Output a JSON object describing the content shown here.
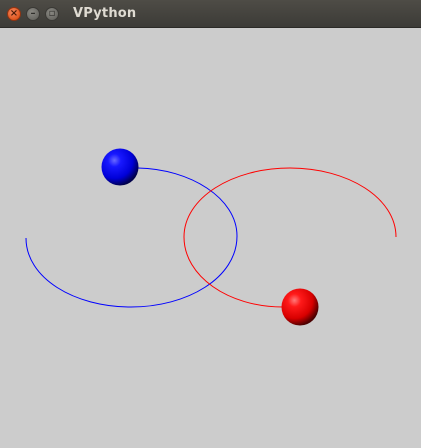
{
  "window": {
    "title": "VPython",
    "controls": {
      "close_glyph": "×",
      "minimize_glyph": "–",
      "maximize_glyph": "▫"
    }
  },
  "scene": {
    "background_color": "#cccccc",
    "objects": [
      {
        "kind": "sphere",
        "name": "blue-sphere",
        "color": "#0000ff"
      },
      {
        "kind": "sphere",
        "name": "red-sphere",
        "color": "#ff0000"
      }
    ],
    "trails": [
      {
        "name": "blue-trail",
        "color": "#0000ff"
      },
      {
        "name": "red-trail",
        "color": "#ff0000"
      }
    ]
  }
}
